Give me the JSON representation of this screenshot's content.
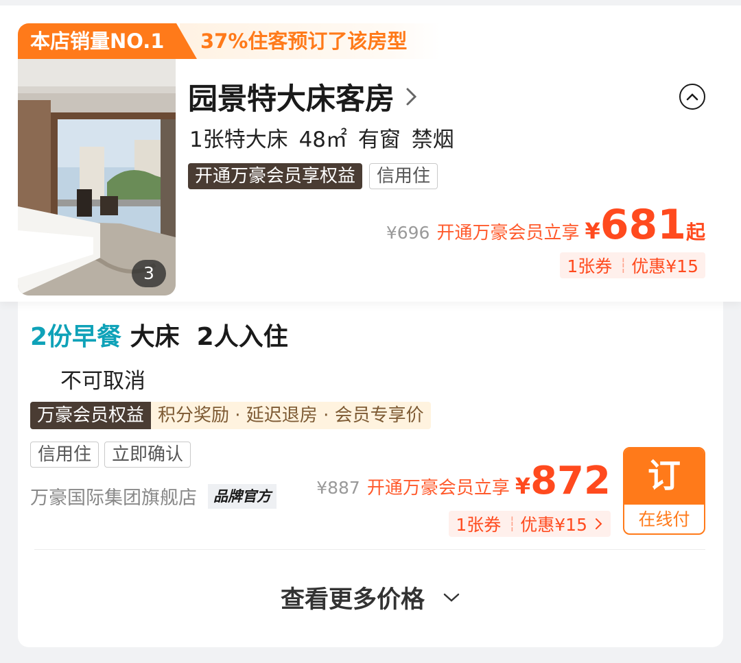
{
  "room": {
    "sales_badge": "本店销量NO.1",
    "booking_ratio": "37%住客预订了该房型",
    "photo_count": "3",
    "title": "园景特大床客房",
    "specs": "1张特大床  48㎡  有窗  禁烟",
    "tags": {
      "member": "开通万豪会员享权益",
      "credit": "信用住"
    },
    "price": {
      "original": "¥696",
      "member_text": "开通万豪会员立享",
      "currency": "¥",
      "amount": "681",
      "suffix": "起"
    },
    "coupon": {
      "count": "1张券",
      "discount": "优惠¥15"
    }
  },
  "rate": {
    "breakfast": "2份早餐",
    "bed_guests": " 大床  2人入住",
    "cancel_policy": "不可取消",
    "benefit_label": "万豪会员权益",
    "benefit_items": "积分奖励 · 延迟退房 · 会员专享价",
    "tags": {
      "credit": "信用住",
      "instant_confirm": "立即确认"
    },
    "store_name": "万豪国际集团旗舰店",
    "brand_badge": "品牌官方",
    "price": {
      "original": "¥887",
      "member_text": "开通万豪会员立享",
      "currency": "¥",
      "amount": "872"
    },
    "coupon": {
      "count": "1张券",
      "discount": "优惠¥15"
    },
    "book_button": {
      "label": "订",
      "sub_label": "在线付"
    }
  },
  "more_prices": "查看更多价格",
  "colors": {
    "accent_orange": "#ff7a1a",
    "price_red": "#ff4a1e",
    "teal": "#0fa2b8",
    "member_brown": "#4a3c33"
  },
  "icons": [
    "chevron-right-icon",
    "collapse-up-icon",
    "chevron-down-icon"
  ]
}
